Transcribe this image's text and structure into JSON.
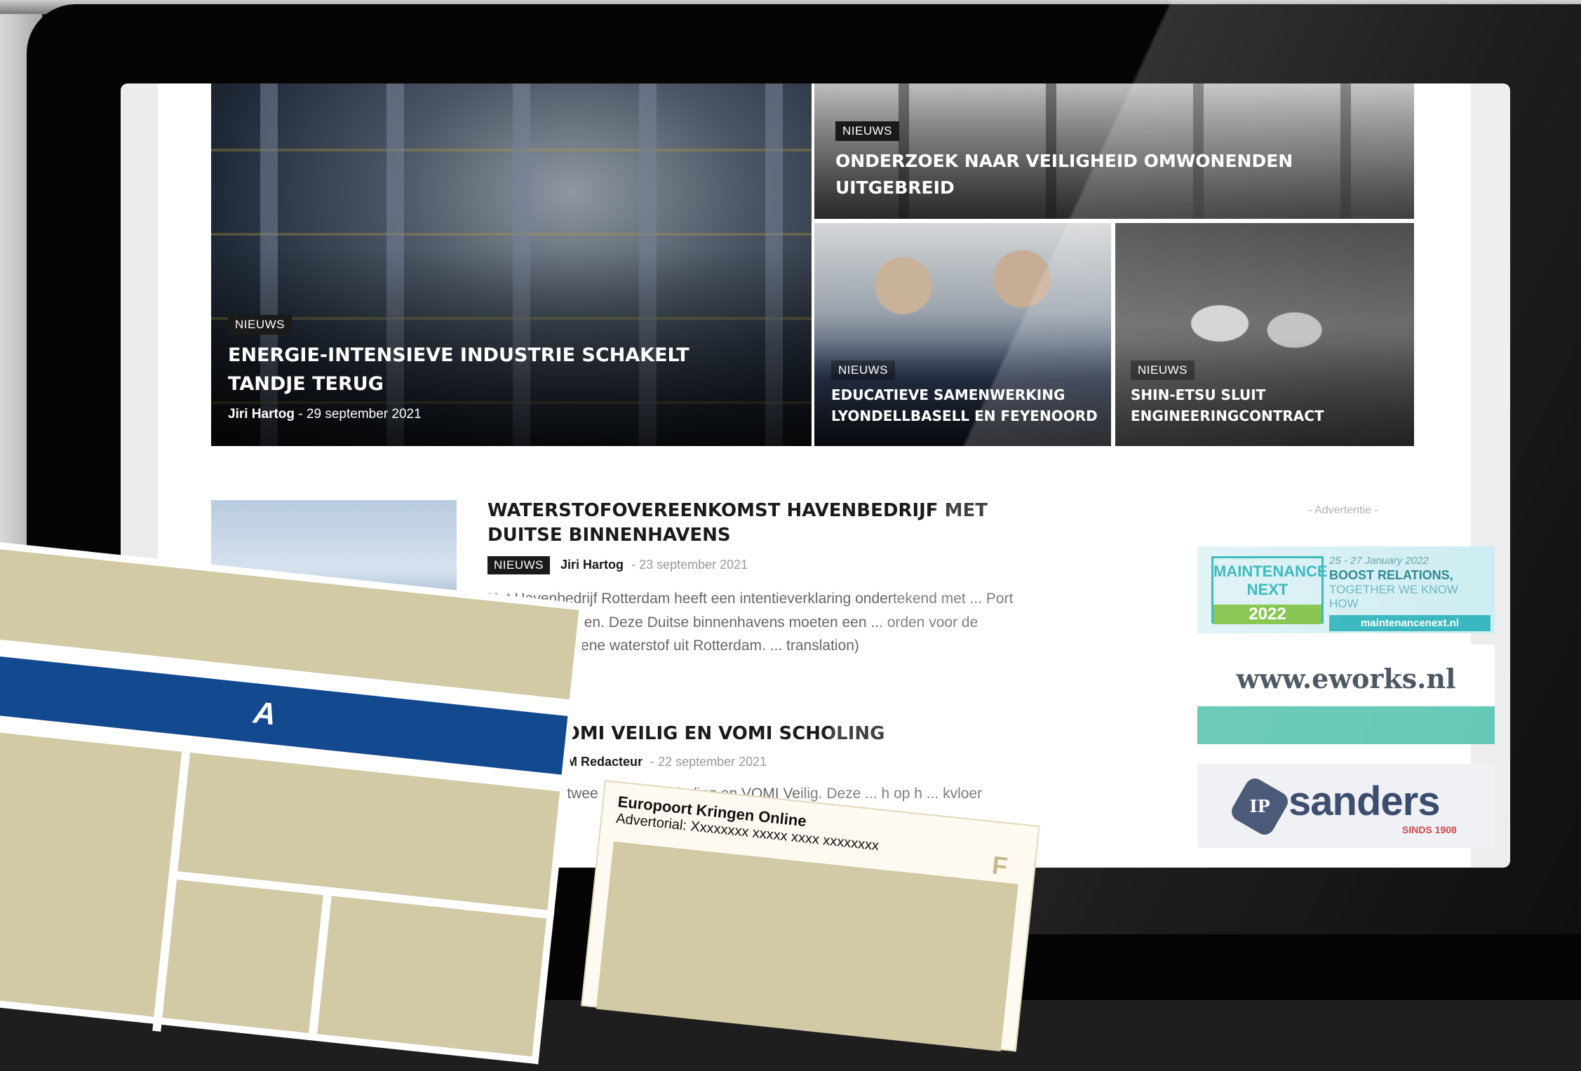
{
  "hero": {
    "main": {
      "tag": "NIEUWS",
      "title": "ENERGIE-INTENSIEVE INDUSTRIE SCHAKELT TANDJE TERUG",
      "author": "Jiri Hartog",
      "separator": "-",
      "date": "29 september 2021"
    },
    "top": {
      "tag": "NIEUWS",
      "title": "ONDERZOEK NAAR VEILIGHEID OMWONENDEN UITGEBREID"
    },
    "bottom_left": {
      "tag": "NIEUWS",
      "title": "EDUCATIEVE SAMENWERKING LYONDELLBASELL EN FEYENOORD"
    },
    "bottom_right": {
      "tag": "NIEUWS",
      "title": "SHIN-ETSU SLUIT ENGINEERINGCONTRACT"
    }
  },
  "articles": [
    {
      "title": "WATERSTOFOVEREENKOMST HAVENBEDRIJF MET DUITSE BINNENHAVENS",
      "tag": "NIEUWS",
      "author": "Jiri Hartog",
      "separator": "-",
      "date": "23 september 2021",
      "excerpt": "Het Havenbedrijf Rotterdam heeft een intentieverklaring ondertekend met ... Port Niederrheinhäfen. Deze Duitse binnenhavens moeten een ... orden voor de invoer van groene waterstof uit Rotterdam. ... translation)"
    },
    {
      "title": "VOMI VEILIG EN VOMI SCHOLING",
      "author": "VFM Redacteur",
      "separator": "-",
      "date": "22 september 2021",
      "excerpt": "... twee ... VOMI Scholing en VOMI Veilig. Deze ... h op h ... kvloer"
    }
  ],
  "sidebar": {
    "ad_label": "- Advertentie -",
    "maintenance": {
      "logo_text": "MAINTENANCE NEXT",
      "logo_year": "2022",
      "dates": "25 - 27 January 2022",
      "headline": "BOOST RELATIONS,",
      "tagline": "TOGETHER WE KNOW HOW",
      "url": "maintenancenext.nl"
    },
    "eworks": {
      "url": "www.eworks.nl"
    },
    "sanders": {
      "logo_ip": "IP",
      "name": "sanders",
      "since": "SINDS 1908"
    }
  },
  "overlay": {
    "card_a_letter": "A",
    "card_f": {
      "title": "Europoort Kringen Online",
      "subtitle": "Advertorial: Xxxxxxxx xxxxx xxxx xxxxxxxx",
      "letter": "F"
    }
  },
  "colors": {
    "tag_bg": "#1a1a1a",
    "card_blue": "#12498f",
    "card_tan": "#d2c9a5",
    "maint_teal": "#2bb3ba"
  }
}
